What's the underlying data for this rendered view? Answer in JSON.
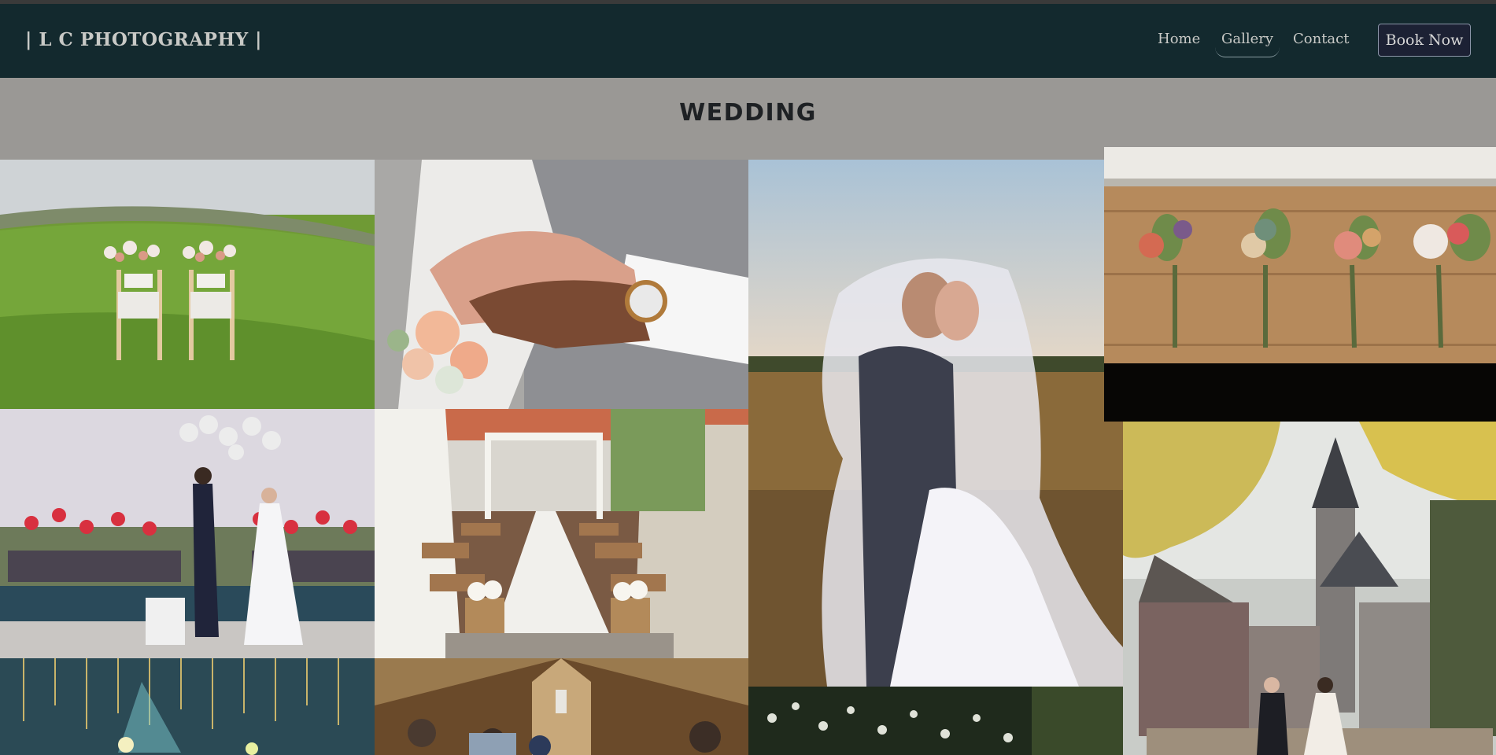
{
  "header": {
    "brand": "| L C PHOTOGRAPHY |",
    "nav": [
      {
        "label": "Home"
      },
      {
        "label": "Gallery",
        "active": true
      },
      {
        "label": "Contact"
      }
    ],
    "book_label": "Book Now"
  },
  "gallery": {
    "title": "WEDDING",
    "photos": [
      {
        "name": "photo-chairs-on-lawn"
      },
      {
        "name": "photo-hands-with-rings"
      },
      {
        "name": "photo-couple-under-veil"
      },
      {
        "name": "photo-boutonnieres"
      },
      {
        "name": "photo-couple-with-balloons"
      },
      {
        "name": "photo-ceremony-aisle"
      },
      {
        "name": "photo-castle-couple"
      },
      {
        "name": "photo-lights-venue"
      },
      {
        "name": "photo-dancing-hall"
      },
      {
        "name": "photo-garden-bottom"
      }
    ]
  },
  "colors": {
    "navbar": "#13292e",
    "page_background": "#9a9895",
    "title_text": "#1e2124",
    "button_background": "#1c2134"
  }
}
